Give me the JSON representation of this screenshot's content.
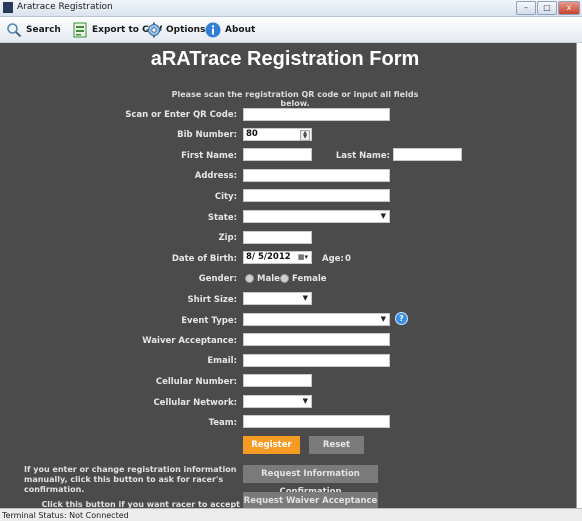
{
  "window": {
    "title": "Aratrace Registration",
    "minimize": "–",
    "maximize": "□",
    "close": "x"
  },
  "toolbar": {
    "search": "Search",
    "export": "Export to CSV",
    "options": "Options",
    "about": "About"
  },
  "form": {
    "heading": "aRATrace Registration Form",
    "instruction": "Please scan the registration QR code or input all fields below.",
    "labels": {
      "qr": "Scan or Enter QR Code:",
      "bib": "Bib Number:",
      "first_name": "First Name:",
      "last_name": "Last Name:",
      "address": "Address:",
      "city": "City:",
      "state": "State:",
      "zip": "Zip:",
      "dob": "Date of Birth:",
      "age": "Age:",
      "gender": "Gender:",
      "shirt": "Shirt Size:",
      "event": "Event Type:",
      "waiver": "Waiver Acceptance:",
      "email": "Email:",
      "cellular": "Cellular Number:",
      "network": "Cellular Network:",
      "team": "Team:"
    },
    "values": {
      "qr": "",
      "bib": "80",
      "first_name": "",
      "last_name": "",
      "address": "",
      "city": "",
      "state": "",
      "zip": "",
      "dob": "8/  5/2012",
      "age": "0",
      "shirt": "",
      "event": "",
      "waiver": "",
      "email": "",
      "cellular": "",
      "network": "",
      "team": ""
    },
    "gender_options": [
      "Male",
      "Female"
    ],
    "buttons": {
      "register": "Register",
      "reset": "Reset",
      "request_info": "Request Information Confirmation",
      "request_waiver": "Request Waiver Acceptance"
    },
    "notes": {
      "manual": "If you enter or change registration information manually, click this button to ask for racer's confirmation.",
      "liability": "Click this button if you want racer to accept the liability"
    }
  },
  "status": {
    "text": "Terminal Status: Not Connected"
  },
  "colors": {
    "panel": "#4b4b4b",
    "accent": "#f59a23",
    "help": "#3a8ee6"
  }
}
